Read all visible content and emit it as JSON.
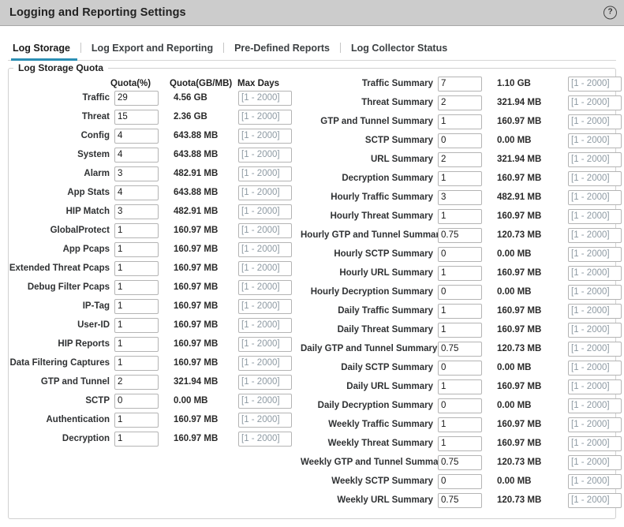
{
  "window": {
    "title": "Logging and Reporting Settings",
    "help_icon": "help-circle-icon",
    "help_glyph": "?"
  },
  "tabs": [
    {
      "label": "Log Storage",
      "active": true
    },
    {
      "label": "Log Export and Reporting",
      "active": false
    },
    {
      "label": "Pre-Defined Reports",
      "active": false
    },
    {
      "label": "Log Collector Status",
      "active": false
    }
  ],
  "panel": {
    "legend": "Log Storage Quota",
    "columns": {
      "quota_percent": "Quota(%)",
      "quota_size": "Quota(GB/MB)",
      "max_days": "Max Days"
    },
    "max_days_placeholder": "[1 - 2000]"
  },
  "accent_color": "#2b8fb4",
  "header_bg": "#cccccc",
  "left_rows": [
    {
      "label": "Traffic",
      "quota": "29",
      "size": "4.56 GB",
      "days": ""
    },
    {
      "label": "Threat",
      "quota": "15",
      "size": "2.36 GB",
      "days": ""
    },
    {
      "label": "Config",
      "quota": "4",
      "size": "643.88 MB",
      "days": ""
    },
    {
      "label": "System",
      "quota": "4",
      "size": "643.88 MB",
      "days": ""
    },
    {
      "label": "Alarm",
      "quota": "3",
      "size": "482.91 MB",
      "days": ""
    },
    {
      "label": "App Stats",
      "quota": "4",
      "size": "643.88 MB",
      "days": ""
    },
    {
      "label": "HIP Match",
      "quota": "3",
      "size": "482.91 MB",
      "days": ""
    },
    {
      "label": "GlobalProtect",
      "quota": "1",
      "size": "160.97 MB",
      "days": ""
    },
    {
      "label": "App Pcaps",
      "quota": "1",
      "size": "160.97 MB",
      "days": ""
    },
    {
      "label": "Extended Threat Pcaps",
      "quota": "1",
      "size": "160.97 MB",
      "days": ""
    },
    {
      "label": "Debug Filter Pcaps",
      "quota": "1",
      "size": "160.97 MB",
      "days": ""
    },
    {
      "label": "IP-Tag",
      "quota": "1",
      "size": "160.97 MB",
      "days": ""
    },
    {
      "label": "User-ID",
      "quota": "1",
      "size": "160.97 MB",
      "days": ""
    },
    {
      "label": "HIP Reports",
      "quota": "1",
      "size": "160.97 MB",
      "days": ""
    },
    {
      "label": "Data Filtering Captures",
      "quota": "1",
      "size": "160.97 MB",
      "days": ""
    },
    {
      "label": "GTP and Tunnel",
      "quota": "2",
      "size": "321.94 MB",
      "days": ""
    },
    {
      "label": "SCTP",
      "quota": "0",
      "size": "0.00 MB",
      "days": ""
    },
    {
      "label": "Authentication",
      "quota": "1",
      "size": "160.97 MB",
      "days": ""
    },
    {
      "label": "Decryption",
      "quota": "1",
      "size": "160.97 MB",
      "days": ""
    }
  ],
  "right_rows": [
    {
      "label": "Traffic Summary",
      "quota": "7",
      "size": "1.10 GB",
      "days": ""
    },
    {
      "label": "Threat Summary",
      "quota": "2",
      "size": "321.94 MB",
      "days": ""
    },
    {
      "label": "GTP and Tunnel Summary",
      "quota": "1",
      "size": "160.97 MB",
      "days": ""
    },
    {
      "label": "SCTP Summary",
      "quota": "0",
      "size": "0.00 MB",
      "days": ""
    },
    {
      "label": "URL Summary",
      "quota": "2",
      "size": "321.94 MB",
      "days": ""
    },
    {
      "label": "Decryption Summary",
      "quota": "1",
      "size": "160.97 MB",
      "days": ""
    },
    {
      "label": "Hourly Traffic Summary",
      "quota": "3",
      "size": "482.91 MB",
      "days": ""
    },
    {
      "label": "Hourly Threat Summary",
      "quota": "1",
      "size": "160.97 MB",
      "days": ""
    },
    {
      "label": "Hourly GTP and Tunnel Summary",
      "quota": "0.75",
      "size": "120.73 MB",
      "days": ""
    },
    {
      "label": "Hourly SCTP Summary",
      "quota": "0",
      "size": "0.00 MB",
      "days": ""
    },
    {
      "label": "Hourly URL Summary",
      "quota": "1",
      "size": "160.97 MB",
      "days": ""
    },
    {
      "label": "Hourly Decryption Summary",
      "quota": "0",
      "size": "0.00 MB",
      "days": ""
    },
    {
      "label": "Daily Traffic Summary",
      "quota": "1",
      "size": "160.97 MB",
      "days": ""
    },
    {
      "label": "Daily Threat Summary",
      "quota": "1",
      "size": "160.97 MB",
      "days": ""
    },
    {
      "label": "Daily GTP and Tunnel Summary",
      "quota": "0.75",
      "size": "120.73 MB",
      "days": ""
    },
    {
      "label": "Daily SCTP Summary",
      "quota": "0",
      "size": "0.00 MB",
      "days": ""
    },
    {
      "label": "Daily URL Summary",
      "quota": "1",
      "size": "160.97 MB",
      "days": ""
    },
    {
      "label": "Daily Decryption Summary",
      "quota": "0",
      "size": "0.00 MB",
      "days": ""
    },
    {
      "label": "Weekly Traffic Summary",
      "quota": "1",
      "size": "160.97 MB",
      "days": ""
    },
    {
      "label": "Weekly Threat Summary",
      "quota": "1",
      "size": "160.97 MB",
      "days": ""
    },
    {
      "label": "Weekly GTP and Tunnel Summary",
      "quota": "0.75",
      "size": "120.73 MB",
      "days": ""
    },
    {
      "label": "Weekly SCTP Summary",
      "quota": "0",
      "size": "0.00 MB",
      "days": ""
    },
    {
      "label": "Weekly URL Summary",
      "quota": "0.75",
      "size": "120.73 MB",
      "days": ""
    }
  ]
}
